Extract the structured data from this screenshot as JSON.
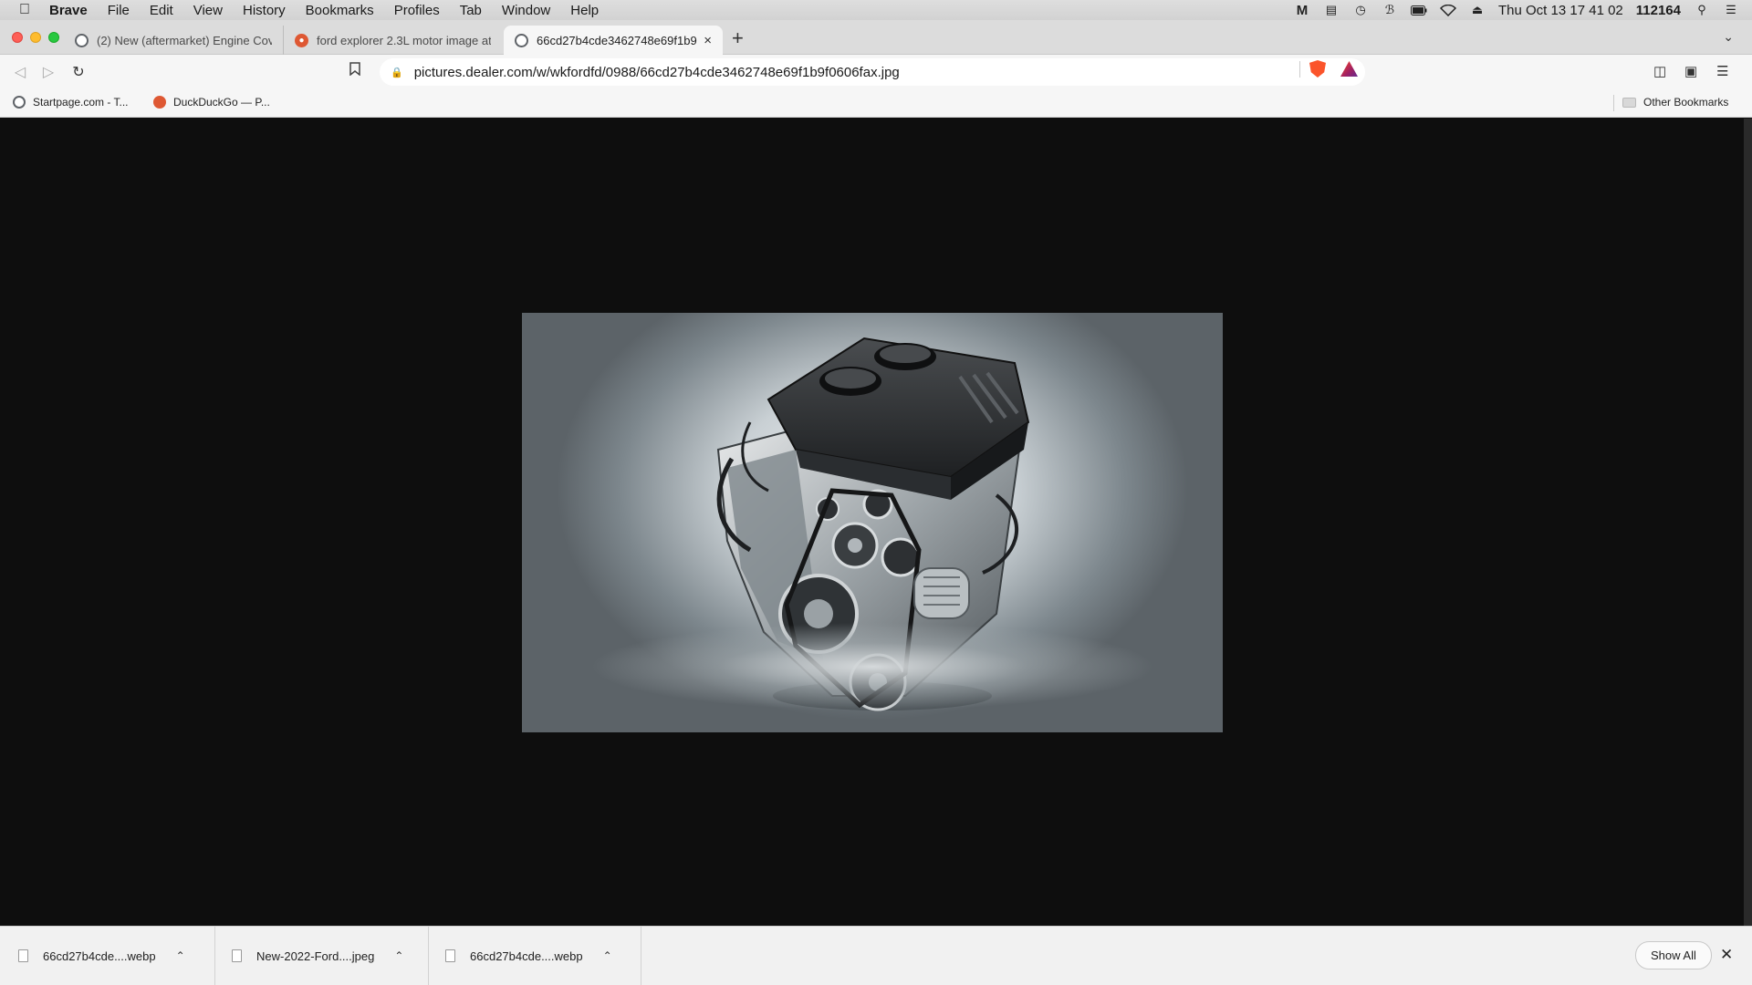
{
  "menubar": {
    "app": "Brave",
    "items": [
      "File",
      "Edit",
      "View",
      "History",
      "Bookmarks",
      "Profiles",
      "Tab",
      "Window",
      "Help"
    ],
    "clock": "Thu Oct 13  17 41 02",
    "extra": "112164"
  },
  "tabs": [
    {
      "title": "(2) New (aftermarket) Engine Cover",
      "icon": "globe-icon"
    },
    {
      "title": "ford explorer 2.3L motor image at D",
      "icon": "duckduckgo-icon"
    },
    {
      "title": "66cd27b4cde3462748e69f1b9",
      "icon": "globe-icon",
      "close": "×"
    }
  ],
  "toolbar": {
    "url": "pictures.dealer.com/w/wkfordfd/0988/66cd27b4cde3462748e69f1b9f0606fax.jpg"
  },
  "bookmarks": {
    "items": [
      {
        "label": "Startpage.com - T...",
        "icon": "startpage-icon"
      },
      {
        "label": "DuckDuckGo — P...",
        "icon": "duckduckgo-icon"
      }
    ],
    "other": "Other Bookmarks"
  },
  "downloads": {
    "items": [
      {
        "name": "66cd27b4cde....webp"
      },
      {
        "name": "New-2022-Ford....jpeg"
      },
      {
        "name": "66cd27b4cde....webp"
      }
    ],
    "show_all": "Show All",
    "close": "✕"
  },
  "colors": {
    "page_background": "#0e0e0e",
    "brave_accent": "#fb542b"
  }
}
